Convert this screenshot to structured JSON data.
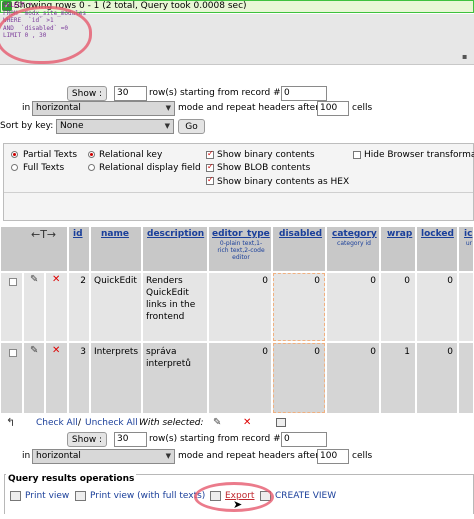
{
  "status": {
    "message": "Showing rows 0 - 1 (2 total, Query took 0.0008 sec)"
  },
  "sql": {
    "lines": [
      "SELECT *",
      "FROM  modx_site_modules",
      "WHERE  `id` >1",
      "AND  `disabled` =0",
      "LIMIT 0 , 30"
    ]
  },
  "navigation_top": {
    "show_label": "Show :",
    "rows_value": "30",
    "rows_text": "row(s) starting from record #",
    "start_value": "0",
    "in_label": "in",
    "mode_value": "horizontal",
    "mode_text": "mode and repeat headers after",
    "repeat_value": "100",
    "cells_text": "cells"
  },
  "sort": {
    "label": "Sort by key:",
    "value": "None",
    "go_label": "Go"
  },
  "options": {
    "partial_texts": "Partial Texts",
    "full_texts": "Full Texts",
    "relational_key": "Relational key",
    "relational_display_field": "Relational display field",
    "show_binary_contents": "Show binary contents",
    "show_blob_contents": "Show BLOB contents",
    "show_binary_as_hex": "Show binary contents as HEX",
    "hide_browser_transformation": "Hide Browser transformation"
  },
  "table": {
    "columns": [
      {
        "name": "id",
        "comment": ""
      },
      {
        "name": "name",
        "comment": ""
      },
      {
        "name": "description",
        "comment": ""
      },
      {
        "name": "editor_type",
        "comment": "0-plain text,1-rich text,2-code editor"
      },
      {
        "name": "disabled",
        "comment": ""
      },
      {
        "name": "category",
        "comment": "category id"
      },
      {
        "name": "wrap",
        "comment": ""
      },
      {
        "name": "locked",
        "comment": ""
      },
      {
        "name": "ic",
        "comment": "ur"
      }
    ],
    "rows": [
      {
        "id": "2",
        "name": "QuickEdit",
        "description": "Renders QuickEdit links in the frontend",
        "editor_type": "0",
        "disabled": "0",
        "category": "0",
        "wrap": "0",
        "locked": "0",
        "ic": ""
      },
      {
        "id": "3",
        "name": "Interprets",
        "description": "správa interpretů",
        "editor_type": "0",
        "disabled": "0",
        "category": "0",
        "wrap": "1",
        "locked": "0",
        "ic": ""
      }
    ]
  },
  "with_selected": {
    "check_all": "Check All",
    "separator": " / ",
    "uncheck_all": "Uncheck All",
    "label": "With selected:"
  },
  "navigation_bottom": {
    "show_label": "Show :",
    "rows_value": "30",
    "rows_text": "row(s) starting from record #",
    "start_value": "0",
    "in_label": "in",
    "mode_value": "horizontal",
    "mode_text": "mode and repeat headers after",
    "repeat_value": "100",
    "cells_text": "cells"
  },
  "operations": {
    "title": "Query results operations",
    "print_view": "Print view",
    "print_view_full": "Print view (with full texts)",
    "export": "Export",
    "create_view": "CREATE VIEW"
  },
  "colors": {
    "success_bg": "#e8f7d6",
    "success_border": "#3ec13e",
    "header_bg": "#c8c8c8",
    "link": "#1a3f9a",
    "annotation": "#e65a6e"
  }
}
